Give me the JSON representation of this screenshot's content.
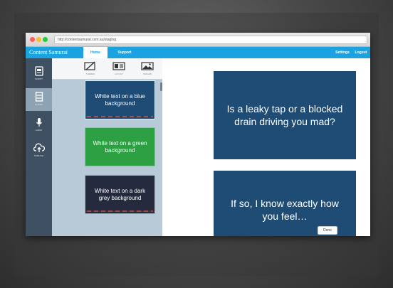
{
  "browser": {
    "url": "http://contentsamurai.com.au/staging"
  },
  "navbar": {
    "brand": "Content Samurai",
    "tabs": {
      "home": "Home",
      "support": "Support",
      "settings": "Settings",
      "logout": "Logout"
    }
  },
  "leftrail": {
    "items": [
      {
        "label": "SCRIPT",
        "icon": "document-icon"
      },
      {
        "label": "SLIDES",
        "icon": "film-icon"
      },
      {
        "label": "AUDIO",
        "icon": "microphone-icon"
      },
      {
        "label": "PUBLISH",
        "icon": "cloud-upload-icon"
      }
    ]
  },
  "panel": {
    "tabs": [
      {
        "label": "THEMES",
        "icon": "pen-icon"
      },
      {
        "label": "LAYOUT",
        "icon": "layout-icon"
      },
      {
        "label": "IMAGES",
        "icon": "image-icon"
      }
    ],
    "thumbnails": [
      {
        "text": "White text on a blue background",
        "color": "#1f4c74"
      },
      {
        "text": "White text on a green background",
        "color": "#2ca043"
      },
      {
        "text": "White text on a dark grey background",
        "color": "#252a3e"
      }
    ]
  },
  "canvas": {
    "slides": [
      {
        "text": "Is a leaky tap or a blocked drain driving you mad?"
      },
      {
        "text": "If so, I know exactly how you feel…"
      }
    ],
    "done_label": "Done"
  },
  "colors": {
    "accent": "#1aa3e0",
    "slide_blue": "#1f4c74",
    "rail": "#3e5061",
    "panel": "#b8cad7"
  }
}
